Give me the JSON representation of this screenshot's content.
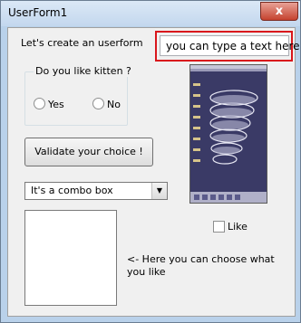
{
  "window": {
    "title": "UserForm1",
    "close_glyph": "x"
  },
  "form": {
    "intro_label": "Let's create an userform",
    "textbox_value": "you can type a text here",
    "kitten_frame_caption": "Do you like kitten ?",
    "radio_yes_label": "Yes",
    "radio_no_label": "No",
    "validate_button_label": "Validate your choice !",
    "combo_value": "It's a combo box",
    "like_checkbox_label": "Like",
    "listbox_hint": "<- Here you can choose what you like"
  },
  "colors": {
    "highlight_border": "#d9161c",
    "image_background": "#3a3a66"
  }
}
